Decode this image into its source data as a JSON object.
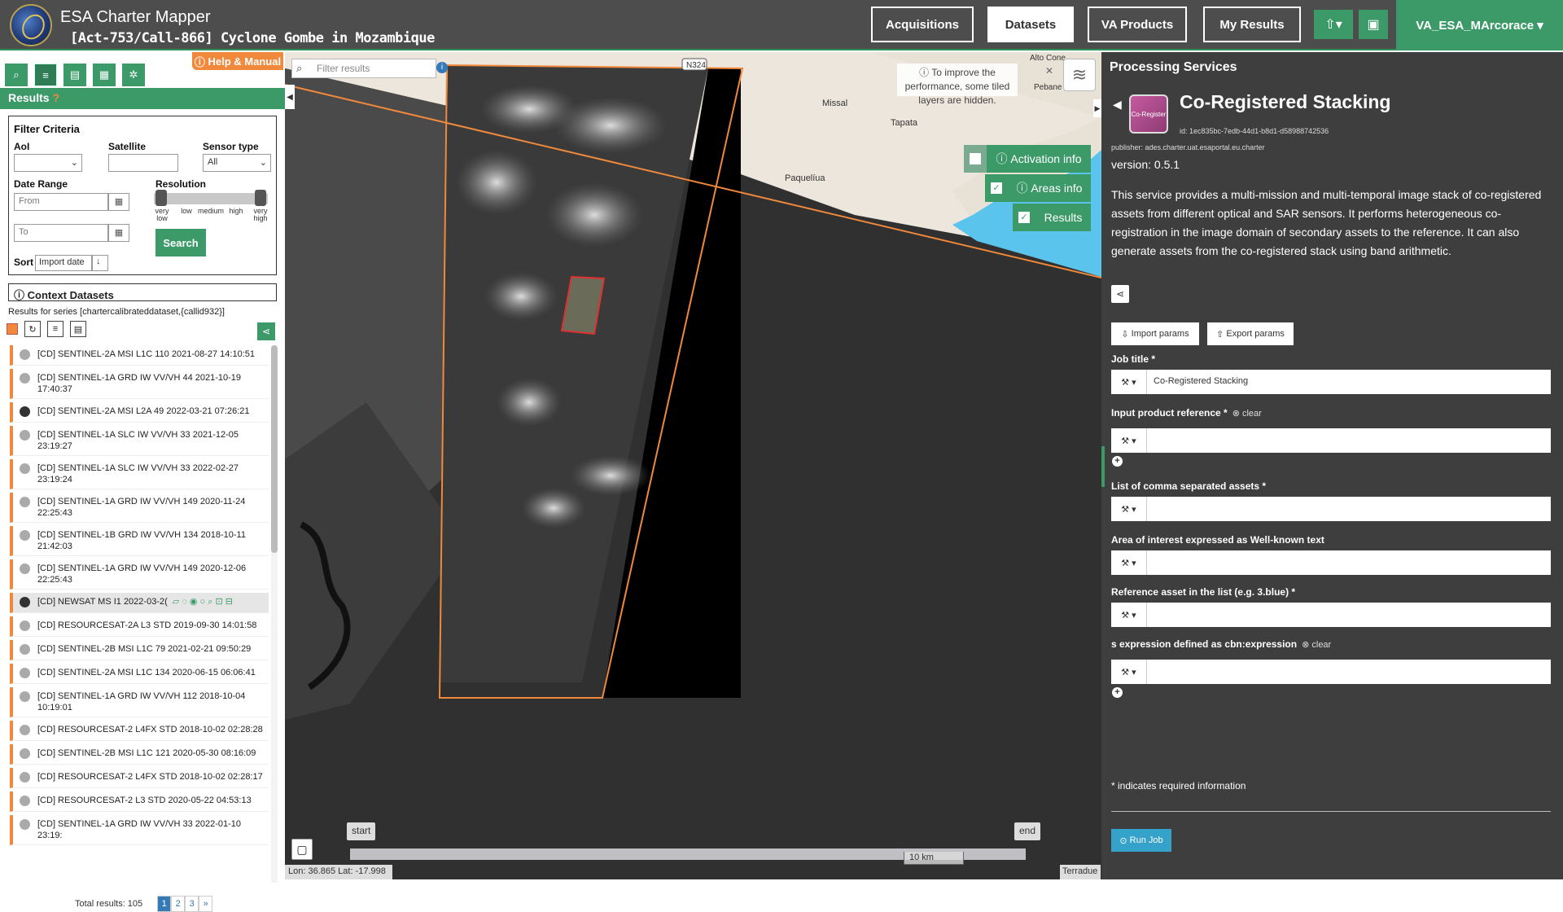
{
  "header": {
    "app_title": "ESA Charter Mapper",
    "activation_title": "[Act-753/Call-866] Cyclone Gombe in Mozambique",
    "nav": [
      "Acquisitions",
      "Datasets",
      "VA Products",
      "My Results"
    ],
    "active_nav": "Datasets",
    "upload_icon": "upload-icon",
    "briefcase_icon": "briefcase-icon",
    "user": "VA_ESA_MArcorace"
  },
  "sidebar": {
    "help_label": "Help & Manual",
    "results_title": "Results",
    "filter": {
      "title": "Filter Criteria",
      "aoi_label": "AoI",
      "satellite_label": "Satellite",
      "sensor_label": "Sensor type",
      "sensor_value": "All",
      "date_label": "Date Range",
      "from_placeholder": "From",
      "to_placeholder": "To",
      "resolution_label": "Resolution",
      "res_ticks": [
        "very low",
        "low",
        "medium",
        "high",
        "very high"
      ],
      "sort_label": "Sort",
      "sort_value": "Import date",
      "search_label": "Search"
    },
    "context_title": "Context Datasets",
    "series_text": "Results for series [chartercalibrateddataset,{callid932}]",
    "items": [
      "[CD] SENTINEL-2A MSI L1C 110 2021-08-27 14:10:51",
      "[CD] SENTINEL-1A GRD IW VV/VH 44 2021-10-19 17:40:37",
      "[CD] SENTINEL-2A MSI L2A 49 2022-03-21 07:26:21",
      "[CD] SENTINEL-1A SLC IW VV/VH 33 2021-12-05 23:19:27",
      "[CD] SENTINEL-1A SLC IW VV/VH 33 2022-02-27 23:19:24",
      "[CD] SENTINEL-1A GRD IW VV/VH 149 2020-11-24 22:25:43",
      "[CD] SENTINEL-1B GRD IW VV/VH 134 2018-10-11 21:42:03",
      "[CD] SENTINEL-1A GRD IW VV/VH 149 2020-12-06 22:25:43",
      "[CD] NEWSAT MS I1 2022-03-2(",
      "[CD] RESOURCESAT-2A L3 STD 2019-09-30 14:01:58",
      "[CD] SENTINEL-2B MSI L1C 79 2021-02-21 09:50:29",
      "[CD] SENTINEL-2A MSI L1C 134 2020-06-15 06:06:41",
      "[CD] SENTINEL-1A GRD IW VV/VH 112 2018-10-04 10:19:01",
      "[CD] RESOURCESAT-2 L4FX STD 2018-10-02 02:28:28",
      "[CD] SENTINEL-2B MSI L1C 121 2020-05-30 08:16:09",
      "[CD] RESOURCESAT-2 L4FX STD 2018-10-02 02:28:17",
      "[CD] RESOURCESAT-2 L3 STD 2020-05-22 04:53:13",
      "[CD] SENTINEL-1A GRD IW VV/VH 33 2022-01-10 23:19:"
    ],
    "total_label": "Total results: 105",
    "pages": [
      "1",
      "2",
      "3",
      "»"
    ]
  },
  "map": {
    "filter_placeholder": "Filter results",
    "info_note": "To improve the performance, some tiled layers are hidden.",
    "activation_info": "Activation info",
    "areas_info": "Areas info",
    "results_label": "Results",
    "place_labels": [
      "Alto Cone",
      "N324",
      "Missal",
      "Tapata",
      "Paquelíua",
      "Pebane"
    ],
    "timeline_start": "start",
    "timeline_end": "end",
    "coords": "Lon: 36.865 Lat: -17.998",
    "scale": "10 km",
    "attribution": "Terradue"
  },
  "processing": {
    "panel_title": "Processing Services",
    "service_name": "Co-Registered Stacking",
    "service_icon_text": "Co-Register",
    "service_id": "id: 1ec835bc-7edb-44d1-b8d1-d58988742536",
    "publisher": "publisher: ades.charter.uat.esaportal.eu.charter",
    "version": "version: 0.5.1",
    "description": "This service provides a multi-mission and multi-temporal image stack of co-registered assets from different optical and SAR sensors. It performs heterogeneous co-registration in the image domain of secondary assets to the reference. It can also generate assets from the co-registered stack using band arithmetic.",
    "import_label": "Import params",
    "export_label": "Export params",
    "fields": [
      {
        "label": "Job title *",
        "value": "Co-Registered Stacking",
        "clear": ""
      },
      {
        "label": "Input product reference *",
        "value": "",
        "clear": "clear"
      },
      {
        "label": "List of comma separated assets *",
        "value": "",
        "clear": ""
      },
      {
        "label": "Area of interest expressed as Well-known text",
        "value": "",
        "clear": ""
      },
      {
        "label": "Reference asset in the list (e.g. 3.blue) *",
        "value": "",
        "clear": ""
      },
      {
        "label": "s expression defined as cbn:expression",
        "value": "",
        "clear": "clear"
      }
    ],
    "required_note": "* indicates required information",
    "run_label": "Run Job"
  },
  "colors": {
    "accent": "#3c9a69",
    "orange": "#f0893c",
    "panel": "#3e3e3e",
    "run": "#35a3c9"
  }
}
